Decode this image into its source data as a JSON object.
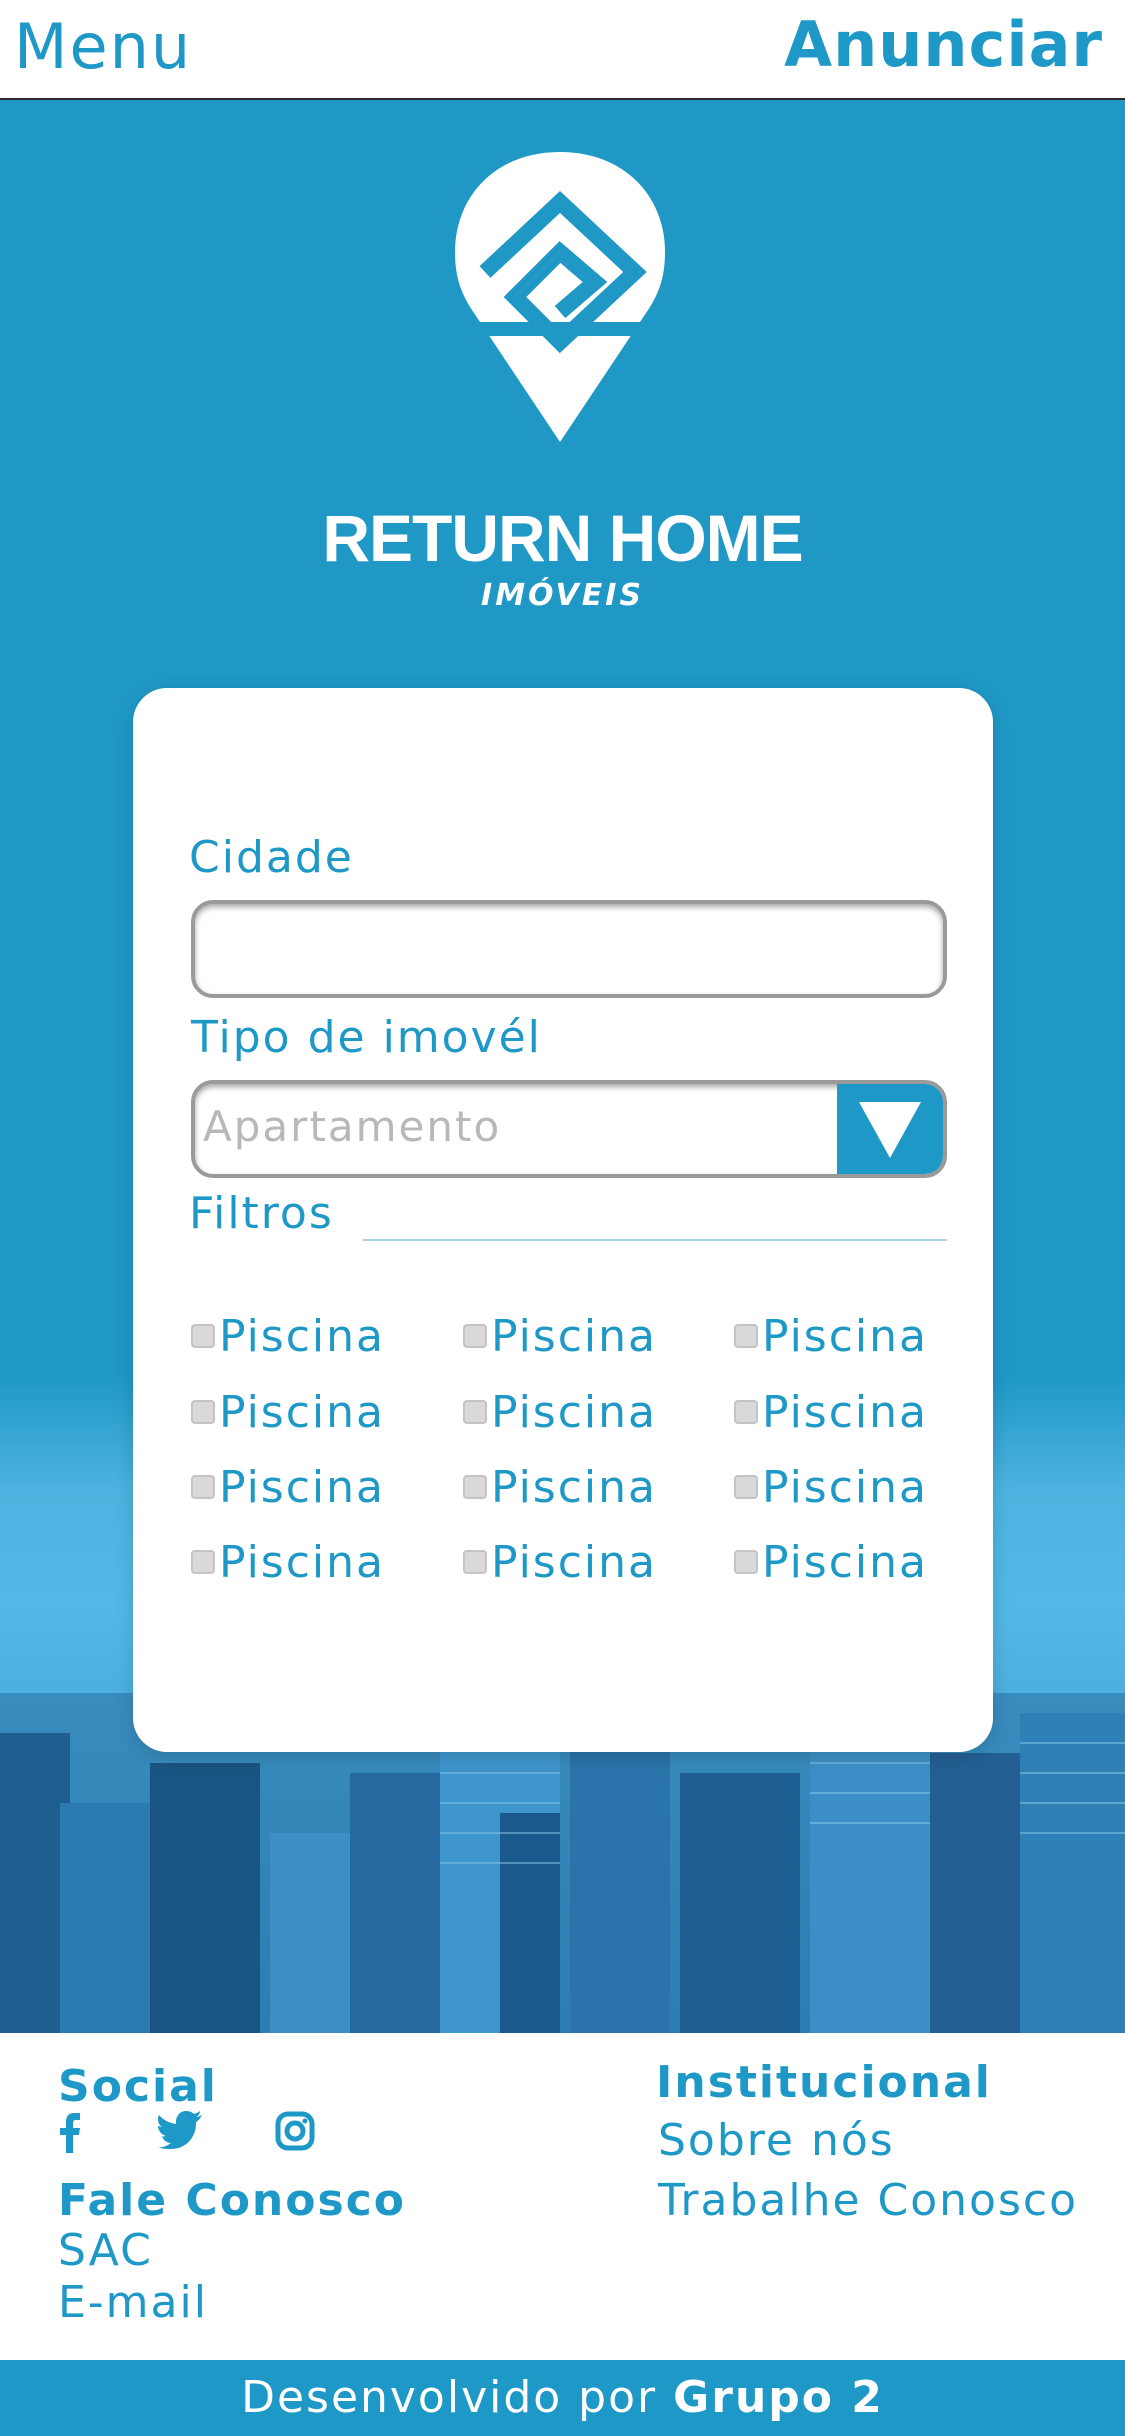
{
  "header": {
    "menu_label": "Menu",
    "announce_label": "Anunciar"
  },
  "brand": {
    "name": "RETURN HOME",
    "subtitle": "IMÓVEIS"
  },
  "search_form": {
    "city_label": "Cidade",
    "city_value": "",
    "type_label": "Tipo de imovél",
    "type_selected": "Apartamento",
    "filters_label": "Filtros",
    "filters": [
      "Piscina",
      "Piscina",
      "Piscina",
      "Piscina",
      "Piscina",
      "Piscina",
      "Piscina",
      "Piscina",
      "Piscina",
      "Piscina",
      "Piscina",
      "Piscina"
    ]
  },
  "footer": {
    "social_heading": "Social",
    "social_icons": [
      "facebook-icon",
      "twitter-icon",
      "instagram-icon"
    ],
    "contact_heading": "Fale Conosco",
    "contact_links": [
      "SAC",
      "E-mail"
    ],
    "institutional_heading": "Institucional",
    "institutional_links": [
      "Sobre nós",
      "Trabalhe Conosco"
    ]
  },
  "credit": {
    "prefix": "Desenvolvido por",
    "team": "Grupo 2"
  },
  "colors": {
    "brand_blue": "#1e98c6",
    "white": "#ffffff"
  }
}
